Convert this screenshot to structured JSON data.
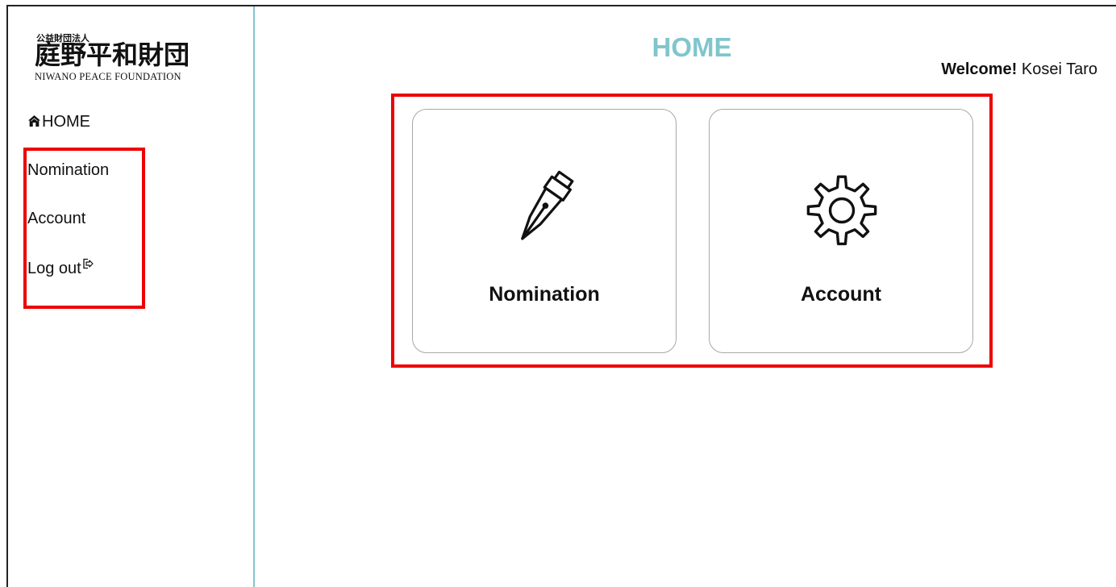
{
  "logo": {
    "small_text": "公益財団法人",
    "big_text": "庭野平和財団",
    "english_text": "NIWANO PEACE FOUNDATION"
  },
  "sidebar": {
    "items": [
      {
        "label": "HOME",
        "icon": "home-icon"
      },
      {
        "label": "Nomination"
      },
      {
        "label": "Account"
      },
      {
        "label": "Log out",
        "icon": "logout-icon"
      }
    ]
  },
  "header": {
    "title": "HOME",
    "welcome_label": "Welcome!",
    "user_name": "Kosei Taro"
  },
  "cards": [
    {
      "label": "Nomination",
      "icon": "fountain-pen-icon"
    },
    {
      "label": "Account",
      "icon": "gear-icon"
    }
  ],
  "colors": {
    "accent": "#7fc6cc",
    "highlight_box": "#ee0000",
    "card_border": "#a8a8a8"
  }
}
